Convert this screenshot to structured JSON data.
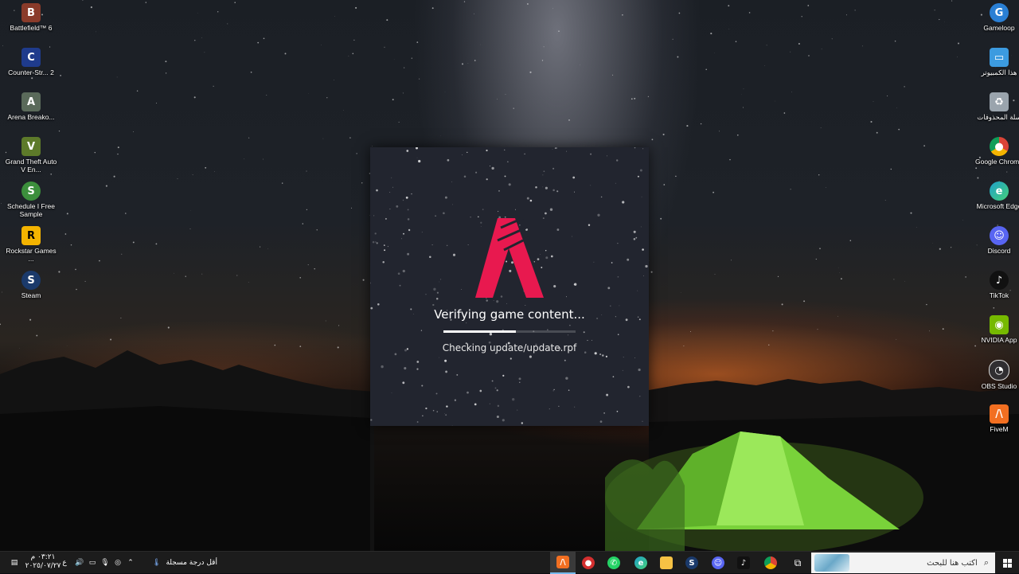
{
  "desktop": {
    "left_icons": [
      {
        "label": "Battlefield™ 6",
        "icon": "battlefield-icon",
        "color": "#8a3b2a"
      },
      {
        "label": "Counter-Str... 2",
        "icon": "counter-strike-icon",
        "color": "#1f3b8c"
      },
      {
        "label": "Arena Breako...",
        "icon": "arena-breakout-icon",
        "color": "#5a6a5a"
      },
      {
        "label": "Grand Theft Auto V En...",
        "icon": "gta-v-icon",
        "color": "#5d7a2a"
      },
      {
        "label": "Schedule I Free Sample",
        "icon": "schedule-i-icon",
        "color": "#3c8f3c"
      },
      {
        "label": "Rockstar Games ...",
        "icon": "rockstar-icon",
        "color": "#f4b400"
      },
      {
        "label": "Steam",
        "icon": "steam-icon",
        "color": "#1b3a6b"
      }
    ],
    "right_icons": [
      {
        "label": "Gameloop",
        "icon": "gameloop-icon",
        "color": "#2a7fd4"
      },
      {
        "label": "هذا الكمبيوتر",
        "icon": "this-pc-icon",
        "color": "#3c9be0"
      },
      {
        "label": "سلة المحذوفات",
        "icon": "recycle-bin-icon",
        "color": "#9aa4ad"
      },
      {
        "label": "Google Chrome",
        "icon": "chrome-icon",
        "color": "#db4437"
      },
      {
        "label": "Microsoft Edge",
        "icon": "edge-icon",
        "color": "#1fa0c9"
      },
      {
        "label": "Discord",
        "icon": "discord-icon",
        "color": "#5865f2"
      },
      {
        "label": "TikTok",
        "icon": "tiktok-icon",
        "color": "#111111"
      },
      {
        "label": "NVIDIA App",
        "icon": "nvidia-icon",
        "color": "#76b900"
      },
      {
        "label": "OBS Studio",
        "icon": "obs-icon",
        "color": "#302e31"
      },
      {
        "label": "FiveM",
        "icon": "fivem-icon",
        "color": "#f26f21"
      }
    ]
  },
  "launcher": {
    "status": "Verifying game content...",
    "progress": 0.55,
    "sub_status": "Checking update/update.rpf",
    "logo_color": "#e8194f"
  },
  "taskbar": {
    "search_placeholder": "اكتب هنا للبحث",
    "weather_text": "أقل درجة مسجلة",
    "clock_time": "٠٣:٢١ م",
    "clock_date": "٢٠٢٥/٠٧/٢٧",
    "language": "ع",
    "apps": [
      {
        "name": "fivem",
        "icon": "fivem-icon",
        "color": "#f26f21"
      },
      {
        "name": "app-red",
        "icon": "red-app-icon",
        "color": "#d32f2f"
      },
      {
        "name": "whatsapp",
        "icon": "whatsapp-icon",
        "color": "#25d366"
      },
      {
        "name": "edge",
        "icon": "edge-icon",
        "color": "#1fa0c9"
      },
      {
        "name": "file-explorer",
        "icon": "folder-icon",
        "color": "#f6c244"
      },
      {
        "name": "steam",
        "icon": "steam-icon",
        "color": "#1b3a6b"
      },
      {
        "name": "discord",
        "icon": "discord-icon",
        "color": "#5865f2"
      },
      {
        "name": "tiktok",
        "icon": "tiktok-icon",
        "color": "#111111"
      },
      {
        "name": "chrome",
        "icon": "chrome-icon",
        "color": "#db4437"
      }
    ]
  }
}
